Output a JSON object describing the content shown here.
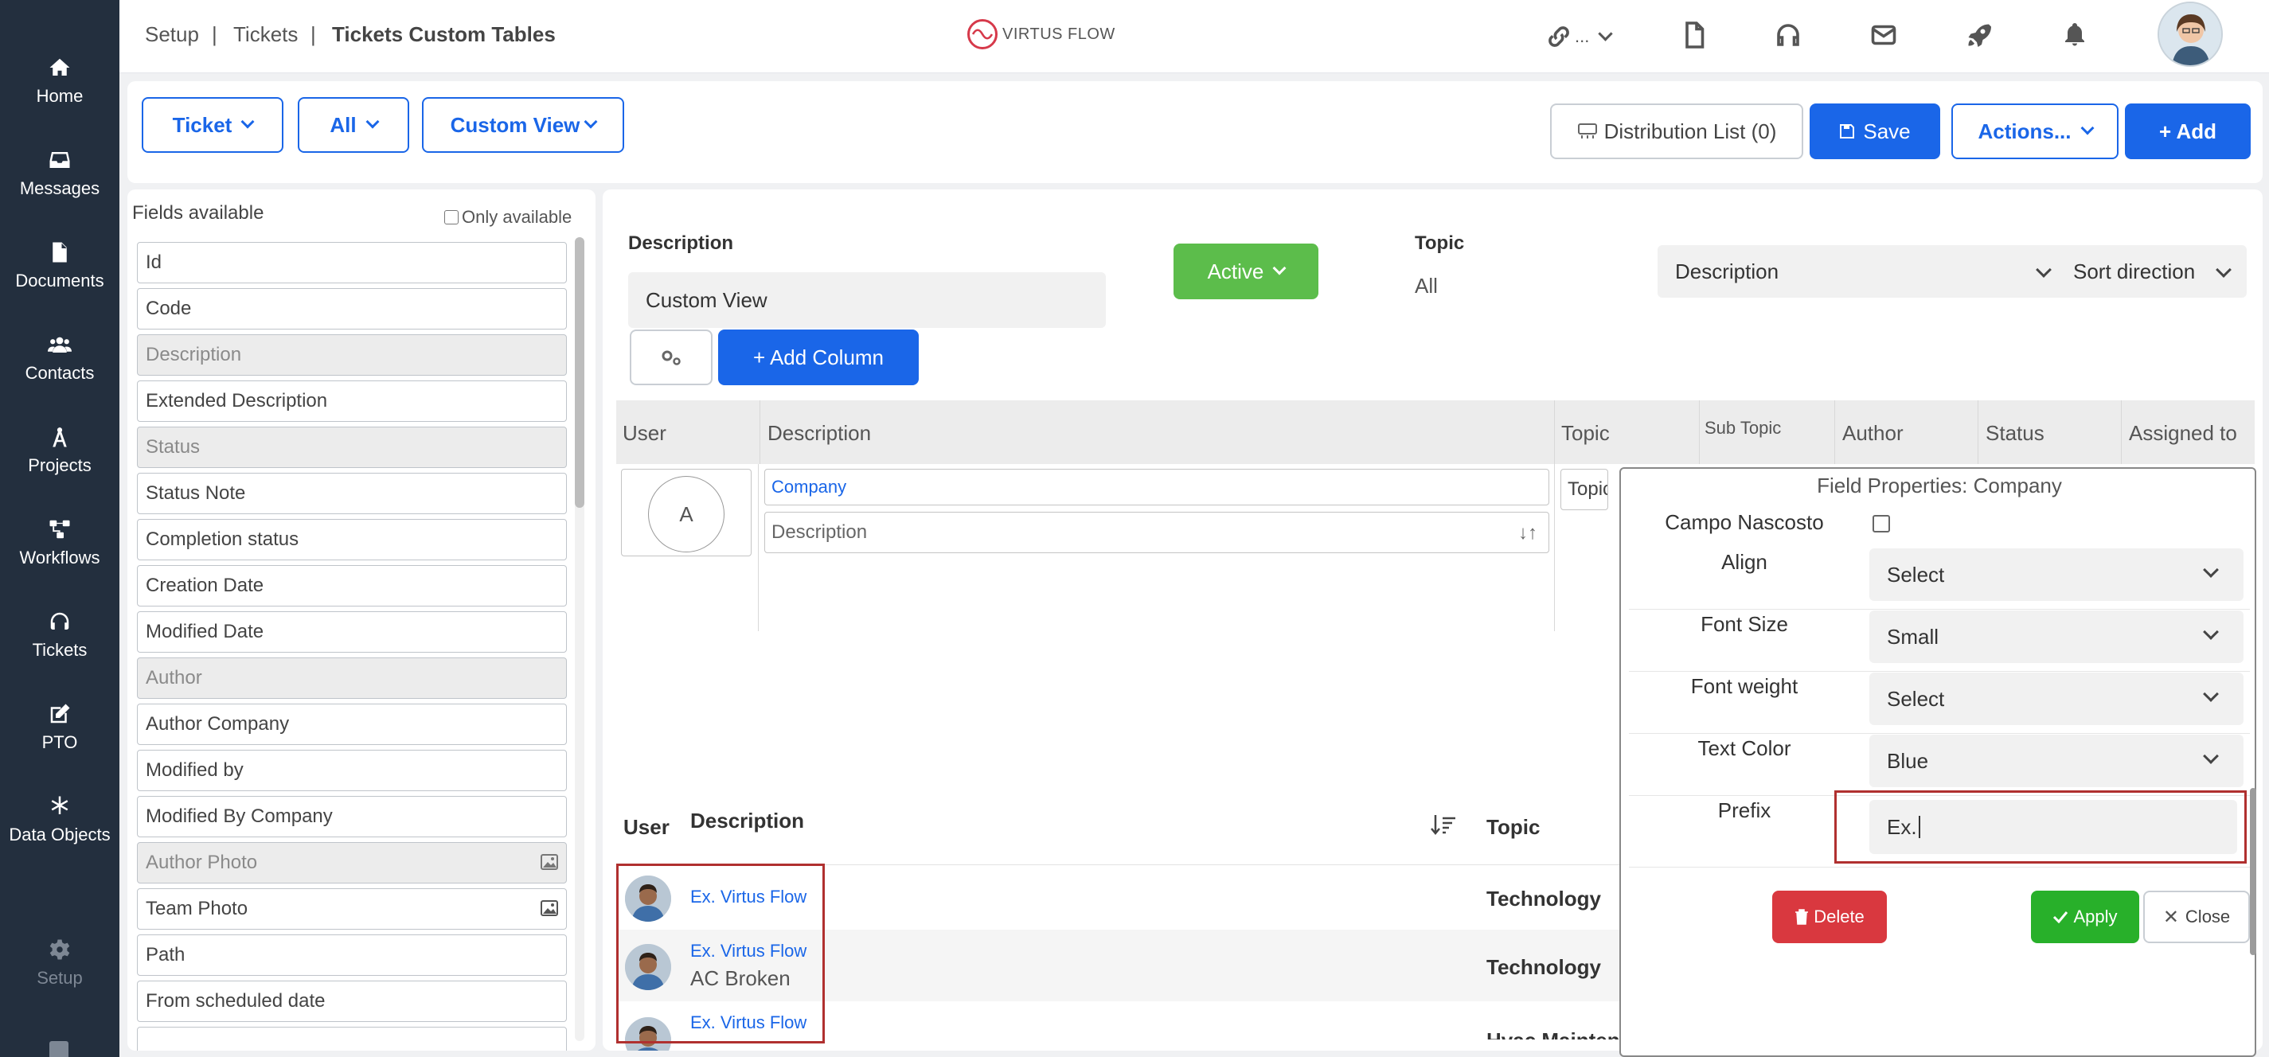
{
  "sidebar": {
    "items": [
      {
        "label": "Home",
        "icon": "home-icon"
      },
      {
        "label": "Messages",
        "icon": "inbox-icon"
      },
      {
        "label": "Documents",
        "icon": "document-icon"
      },
      {
        "label": "Contacts",
        "icon": "users-icon"
      },
      {
        "label": "Projects",
        "icon": "compass-icon"
      },
      {
        "label": "Workflows",
        "icon": "workflow-icon"
      },
      {
        "label": "Tickets",
        "icon": "headset-icon"
      },
      {
        "label": "PTO",
        "icon": "edit-icon"
      },
      {
        "label": "Data Objects",
        "icon": "asterisk-icon"
      },
      {
        "label": "Setup",
        "icon": "gear-icon"
      }
    ]
  },
  "header": {
    "breadcrumb": [
      "Setup",
      "Tickets",
      "Tickets Custom Tables"
    ],
    "separator": "|",
    "logo_text": "VIRTUS FLOW",
    "link_menu_label": "..."
  },
  "toolbar": {
    "ticket_label": "Ticket",
    "all_label": "All",
    "custom_view_label": "Custom View",
    "distribution_label": "Distribution List (0)",
    "save_label": "Save",
    "actions_label": "Actions...",
    "add_label": "+ Add"
  },
  "fields_panel": {
    "title": "Fields available",
    "only_available": "Only available",
    "fields": [
      {
        "label": "Id",
        "disabled": false
      },
      {
        "label": "Code",
        "disabled": false
      },
      {
        "label": "Description",
        "disabled": true
      },
      {
        "label": "Extended Description",
        "disabled": false
      },
      {
        "label": "Status",
        "disabled": true
      },
      {
        "label": "Status Note",
        "disabled": false
      },
      {
        "label": "Completion status",
        "disabled": false
      },
      {
        "label": "Creation Date",
        "disabled": false
      },
      {
        "label": "Modified Date",
        "disabled": false
      },
      {
        "label": "Author",
        "disabled": true
      },
      {
        "label": "Author Company",
        "disabled": false
      },
      {
        "label": "Modified by",
        "disabled": false
      },
      {
        "label": "Modified By Company",
        "disabled": false
      },
      {
        "label": "Author Photo",
        "disabled": true
      },
      {
        "label": "Team Photo",
        "disabled": false
      },
      {
        "label": "Path",
        "disabled": false
      },
      {
        "label": "From scheduled date",
        "disabled": false
      }
    ]
  },
  "view_config": {
    "description_label": "Description",
    "description_value": "Custom View",
    "status_value": "Active",
    "topic_label": "Topic",
    "topic_value": "All",
    "sort_field": "Description",
    "sort_direction": "Sort direction",
    "add_column_label": "+ Add Column"
  },
  "preview": {
    "columns": [
      "User",
      "Description",
      "Topic",
      "Sub Topic",
      "Author",
      "Status",
      "Assigned to"
    ],
    "avatar_letter": "A",
    "company_field": "Company",
    "description_field": "Description",
    "topic_field": "Topic"
  },
  "results": {
    "columns": [
      "User",
      "Description",
      "Topic"
    ],
    "rows": [
      {
        "link": "Ex. Virtus Flow",
        "subtitle": "",
        "topic": "Technology"
      },
      {
        "link": "Ex. Virtus Flow",
        "subtitle": "AC Broken",
        "topic": "Technology"
      },
      {
        "link": "Ex. Virtus Flow",
        "subtitle": "",
        "topic": "Hvac Maintena"
      }
    ]
  },
  "field_properties": {
    "title": "Field Properties: Company",
    "hidden_label": "Campo Nascosto",
    "align_label": "Align",
    "align_value": "Select",
    "font_size_label": "Font Size",
    "font_size_value": "Small",
    "font_weight_label": "Font weight",
    "font_weight_value": "Select",
    "text_color_label": "Text Color",
    "text_color_value": "Blue",
    "prefix_label": "Prefix",
    "prefix_value": "Ex.",
    "delete_label": "Delete",
    "apply_label": "Apply",
    "close_label": "Close"
  },
  "colors": {
    "sidebar_bg": "#232f3e",
    "primary": "#1a66e8",
    "success": "#5cbd4b",
    "danger": "#d9383f",
    "highlight_border": "#b0302f"
  }
}
